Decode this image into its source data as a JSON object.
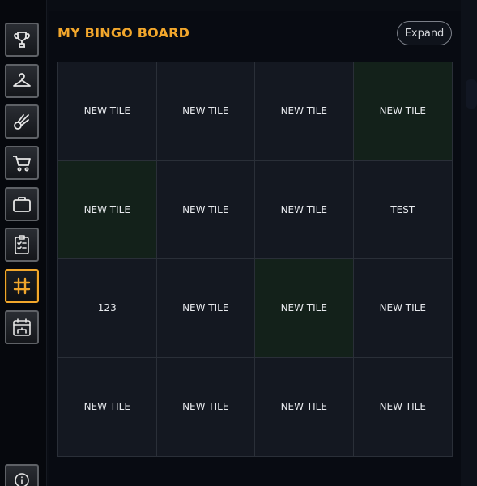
{
  "sidebar": {
    "items": [
      {
        "icon": "trophy-icon"
      },
      {
        "icon": "hanger-icon"
      },
      {
        "icon": "comet-icon"
      },
      {
        "icon": "shopping-cart-icon"
      },
      {
        "icon": "briefcase-icon"
      },
      {
        "icon": "clipboard-checklist-icon"
      },
      {
        "icon": "hashtag-icon",
        "active": true
      },
      {
        "icon": "calendar-cake-icon"
      }
    ],
    "bottom_icon": "info-icon"
  },
  "board": {
    "title": "MY BINGO BOARD",
    "expand_label": "Expand",
    "tiles": [
      {
        "label": "NEW TILE",
        "completed": false
      },
      {
        "label": "NEW TILE",
        "completed": false
      },
      {
        "label": "NEW TILE",
        "completed": false
      },
      {
        "label": "NEW TILE",
        "completed": true
      },
      {
        "label": "NEW TILE",
        "completed": true
      },
      {
        "label": "NEW TILE",
        "completed": false
      },
      {
        "label": "NEW TILE",
        "completed": false
      },
      {
        "label": "TEST",
        "completed": false
      },
      {
        "label": "123",
        "completed": false
      },
      {
        "label": "NEW TILE",
        "completed": false
      },
      {
        "label": "NEW TILE",
        "completed": true
      },
      {
        "label": "NEW TILE",
        "completed": false
      },
      {
        "label": "NEW TILE",
        "completed": false
      },
      {
        "label": "NEW TILE",
        "completed": false
      },
      {
        "label": "NEW TILE",
        "completed": false
      },
      {
        "label": "NEW TILE",
        "completed": false
      }
    ]
  },
  "colors": {
    "accent": "#f2a72c",
    "tile_bg": "#141821",
    "tile_completed_bg": "#13211a"
  }
}
